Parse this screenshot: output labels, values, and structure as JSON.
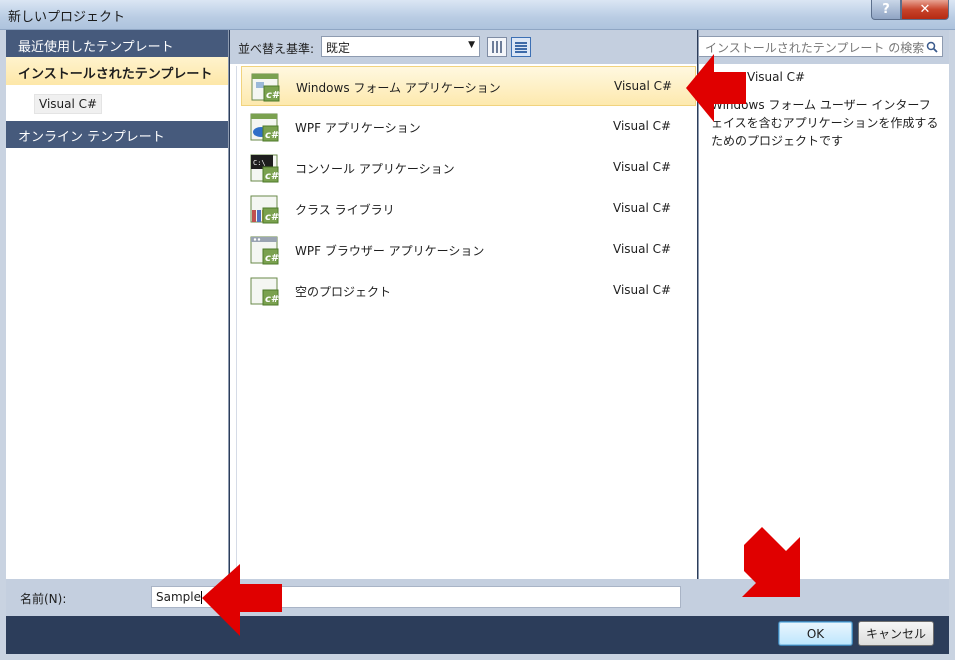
{
  "window": {
    "title": "新しいプロジェクト",
    "help_glyph": "?",
    "close_glyph": "✕"
  },
  "sidebar": {
    "recent_header": "最近使用したテンプレート",
    "installed_header": "インストールされたテンプレート",
    "installed_child": "Visual C#",
    "online_header": "オンライン テンプレート"
  },
  "toolbar": {
    "sort_label": "並べ替え基準:",
    "sort_value": "既定",
    "sort_arrow": "▼"
  },
  "templates": [
    {
      "name": "Windows フォーム アプリケーション",
      "language": "Visual C#",
      "icon": "winforms-icon",
      "selected": true
    },
    {
      "name": "WPF アプリケーション",
      "language": "Visual C#",
      "icon": "wpf-icon",
      "selected": false
    },
    {
      "name": "コンソール アプリケーション",
      "language": "Visual C#",
      "icon": "console-icon",
      "selected": false
    },
    {
      "name": "クラス ライブラリ",
      "language": "Visual C#",
      "icon": "class-library-icon",
      "selected": false
    },
    {
      "name": "WPF ブラウザー アプリケーション",
      "language": "Visual C#",
      "icon": "wpf-browser-icon",
      "selected": false
    },
    {
      "name": "空のプロジェクト",
      "language": "Visual C#",
      "icon": "empty-project-icon",
      "selected": false
    }
  ],
  "details": {
    "search_placeholder": "インストールされたテンプレート の検索",
    "type": "Visual C#",
    "description": "Windows フォーム ユーザー インターフェイスを含むアプリケーションを作成するためのプロジェクトです"
  },
  "footer": {
    "name_label": "名前(N):",
    "name_value": "Sample",
    "ok_label": "OK",
    "cancel_label": "キャンセル"
  },
  "colors": {
    "annotation_arrow": "#e00000",
    "header_bg": "#465a7c",
    "selection_bg": "#fde9ae"
  }
}
